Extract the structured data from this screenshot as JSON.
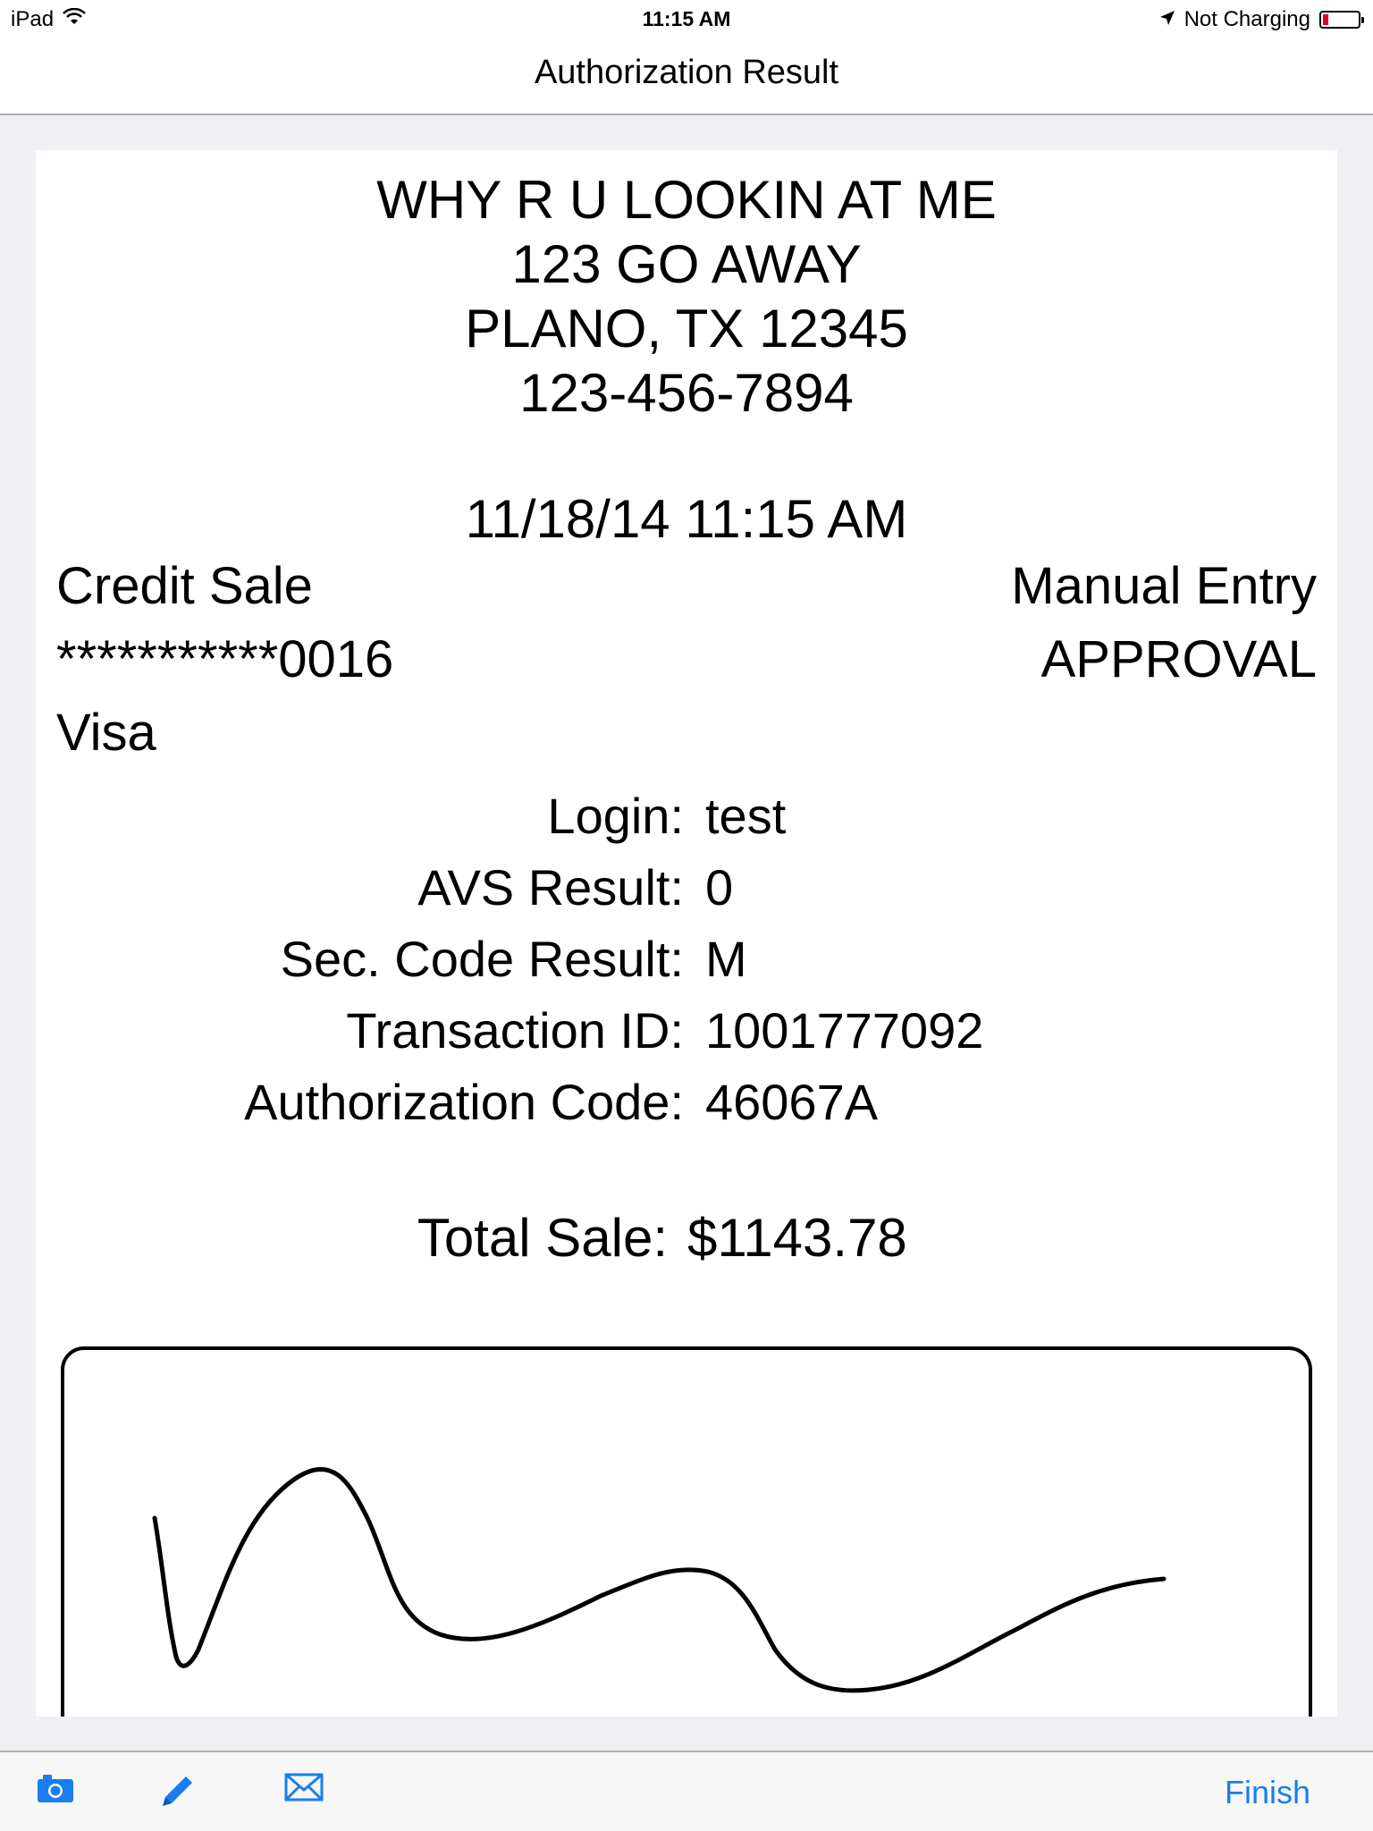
{
  "status_bar": {
    "device": "iPad",
    "time": "11:15 AM",
    "charging": "Not Charging"
  },
  "nav": {
    "title": "Authorization Result"
  },
  "receipt": {
    "merchant_name": "WHY R U LOOKIN AT ME",
    "address_line": "123 GO AWAY",
    "city_line": "PLANO, TX 12345",
    "phone": "123-456-7894",
    "datetime": "11/18/14 11:15 AM",
    "transaction_type": "Credit Sale",
    "entry_mode": "Manual Entry",
    "card_number": "***********0016",
    "status": "APPROVAL",
    "card_brand": "Visa",
    "details": [
      {
        "label": "Login:",
        "value": "test"
      },
      {
        "label": "AVS Result:",
        "value": "0"
      },
      {
        "label": "Sec. Code Result:",
        "value": "M"
      },
      {
        "label": "Transaction ID:",
        "value": "1001777092"
      },
      {
        "label": "Authorization Code:",
        "value": "46067A"
      }
    ],
    "total_label": "Total Sale:",
    "total_value": "$1143.78"
  },
  "toolbar": {
    "finish_label": "Finish",
    "icons": [
      "camera-icon",
      "pencil-icon",
      "mail-icon"
    ],
    "accent_color": "#1a7ef0"
  }
}
